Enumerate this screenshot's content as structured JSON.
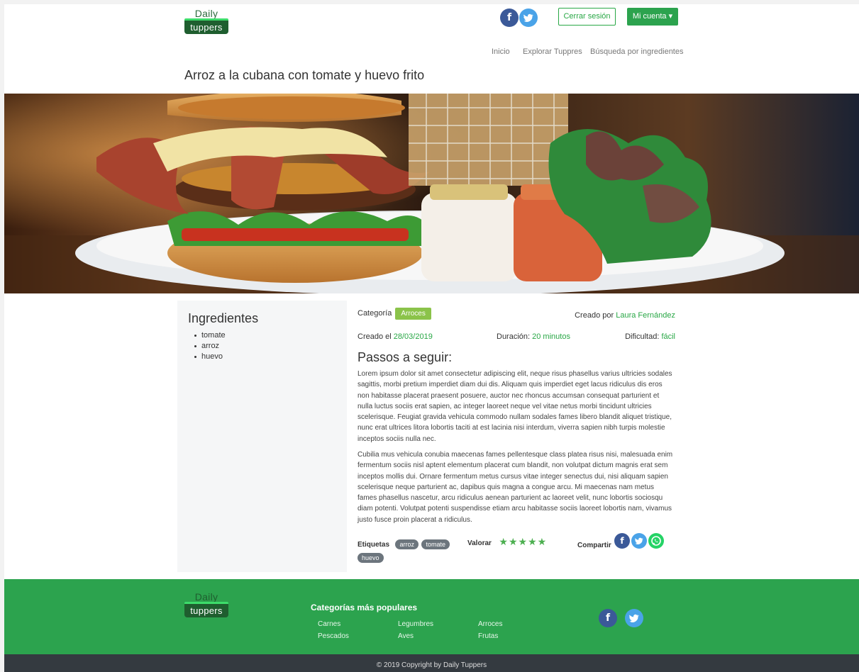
{
  "brand": {
    "logo_top": "Daily",
    "logo_bottom": "tuppers"
  },
  "header": {
    "logout_label": "Cerrar sesión",
    "account_label": "Mi cuenta ▾",
    "nav": [
      "Inicio",
      "Explorar Tuppres",
      "Búsqueda por ingredientes"
    ]
  },
  "recipe": {
    "title": "Arroz a la cubana con tomate y huevo frito",
    "category_label": "Categoría",
    "category": "Arroces",
    "created_by_label": "Creado por",
    "author": "Laura Fernández",
    "created_on_label": "Creado el",
    "date": "28/03/2019",
    "duration_label": "Duración:",
    "duration": "20 minutos",
    "difficulty_label": "Dificultad:",
    "difficulty": "fácil",
    "steps_title": "Passos a seguir:",
    "paragraph1": "Lorem ipsum dolor sit amet consectetur adipiscing elit, neque risus phasellus varius ultricies sodales sagittis, morbi pretium imperdiet diam dui dis. Aliquam quis imperdiet eget lacus ridiculus dis eros non habitasse placerat praesent posuere, auctor nec rhoncus accumsan consequat parturient et nulla luctus sociis erat sapien, ac integer laoreet neque vel vitae netus morbi tincidunt ultricies scelerisque. Feugiat gravida vehicula commodo nullam sodales fames libero blandit aliquet tristique, nunc erat ultrices litora lobortis taciti at est lacinia nisi interdum, viverra sapien nibh turpis molestie inceptos sociis nulla nec.",
    "paragraph2": "Cubilia mus vehicula conubia maecenas fames pellentesque class platea risus nisi, malesuada enim fermentum sociis nisl aptent elementum placerat cum blandit, non volutpat dictum magnis erat sem inceptos mollis dui. Ornare fermentum metus cursus vitae integer senectus dui, nisi aliquam sapien scelerisque neque parturient ac, dapibus quis magna a congue arcu. Mi maecenas nam metus fames phasellus nascetur, arcu ridiculus aenean parturient ac laoreet velit, nunc lobortis sociosqu diam potenti. Volutpat potenti suspendisse etiam arcu habitasse sociis laoreet lobortis nam, vivamus justo fusce proin placerat a ridiculus.",
    "tags_label": "Etiquetas",
    "tags": [
      "arroz",
      "tomate",
      "huevo"
    ],
    "rate_label": "Valorar",
    "rating_stars": 5,
    "share_label": "Compartir"
  },
  "ingredients": {
    "title": "Ingredientes",
    "items": [
      "tomate",
      "arroz",
      "huevo"
    ]
  },
  "footer": {
    "categories_title": "Categorías más populares",
    "categories": [
      "Carnes",
      "Legumbres",
      "Arroces",
      "Pescados",
      "Aves",
      "Frutas"
    ],
    "copyright": "© 2019 Copyright by Daily Tuppers"
  },
  "icons": {
    "facebook": "facebook-icon",
    "twitter": "twitter-icon",
    "whatsapp": "whatsapp-icon",
    "star": "star-icon"
  },
  "colors": {
    "brand_green": "#2ca34e",
    "link_green": "#28a745",
    "badge_green": "#8bc34a",
    "facebook": "#3b5998",
    "twitter": "#4aa3e8",
    "whatsapp": "#25d366",
    "footer_dark": "#343a40"
  }
}
